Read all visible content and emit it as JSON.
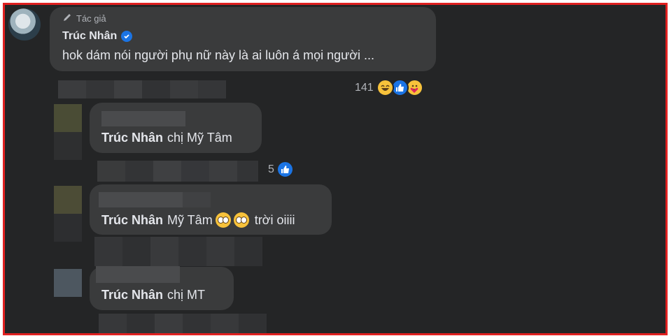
{
  "post": {
    "author_badge": "Tác giả",
    "author_name": "Trúc Nhân",
    "text": "hok dám nói người phụ nữ này là ai luôn á mọi người ...",
    "reaction_count": "141"
  },
  "replies": [
    {
      "mention": "Trúc Nhân",
      "text": "chị Mỹ Tâm",
      "reaction_count": "5"
    },
    {
      "mention": "Trúc Nhân",
      "text_before": "Mỹ Tâm",
      "text_after": "trời oiiii"
    },
    {
      "mention": "Trúc Nhân",
      "text": "chị MT"
    }
  ],
  "colors": {
    "background": "#242526",
    "bubble": "#3a3b3c",
    "frame": "#e02020",
    "like_blue": "#1b74e4"
  }
}
